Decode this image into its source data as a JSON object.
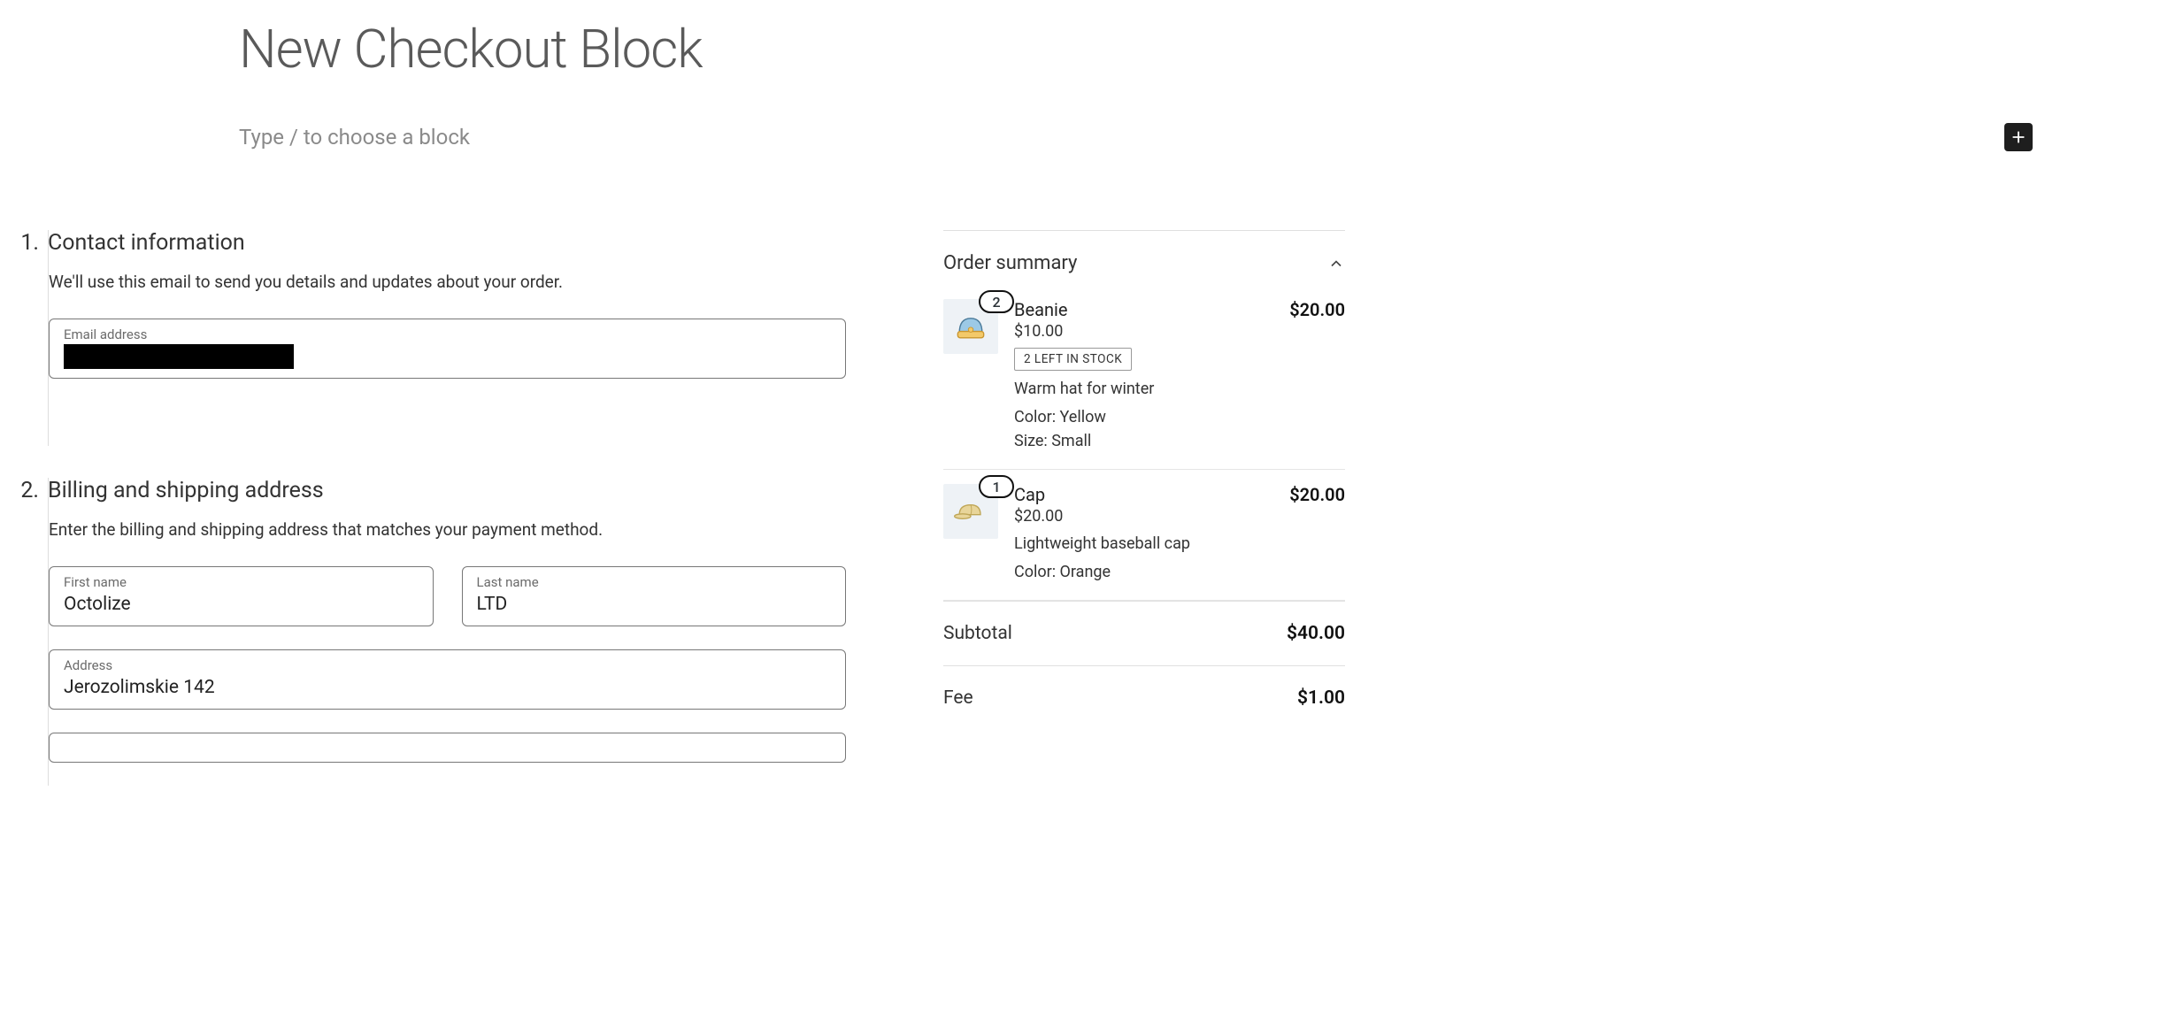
{
  "header": {
    "title": "New Checkout Block",
    "prompt": "Type / to choose a block"
  },
  "steps": {
    "contact": {
      "num": "1.",
      "heading": "Contact information",
      "desc": "We'll use this email to send you details and updates about your order.",
      "email_label": "Email address",
      "email_value": ""
    },
    "billing": {
      "num": "2.",
      "heading": "Billing and shipping address",
      "desc": "Enter the billing and shipping address that matches your payment method.",
      "first_name_label": "First name",
      "first_name_value": "Octolize",
      "last_name_label": "Last name",
      "last_name_value": "LTD",
      "address_label": "Address",
      "address_value": "Jerozolimskie 142"
    }
  },
  "summary": {
    "title": "Order summary",
    "items": [
      {
        "qty": "2",
        "name": "Beanie",
        "total": "$20.00",
        "unit": "$10.00",
        "stock": "2 LEFT IN STOCK",
        "desc": "Warm hat for winter",
        "attrs": [
          "Color: Yellow",
          "Size: Small"
        ]
      },
      {
        "qty": "1",
        "name": "Cap",
        "total": "$20.00",
        "unit": "$20.00",
        "stock": "",
        "desc": "Lightweight baseball cap",
        "attrs": [
          "Color: Orange"
        ]
      }
    ],
    "subtotal_label": "Subtotal",
    "subtotal_value": "$40.00",
    "fee_label": "Fee",
    "fee_value": "$1.00"
  }
}
